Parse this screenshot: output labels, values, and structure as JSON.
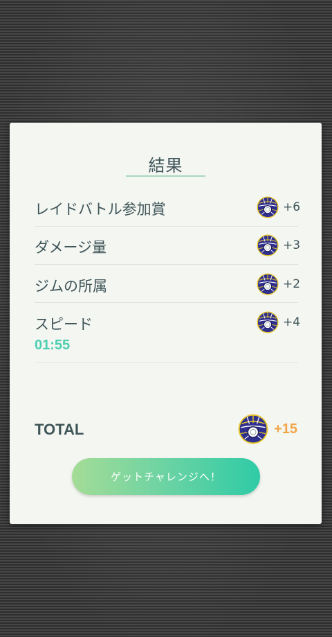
{
  "result": {
    "title": "結果",
    "rows": [
      {
        "label": "レイドバトル参加賞",
        "value": "+6",
        "icon": "premier-ball-icon"
      },
      {
        "label": "ダメージ量",
        "value": "+3",
        "icon": "premier-ball-icon"
      },
      {
        "label": "ジムの所属",
        "value": "+2",
        "icon": "premier-ball-icon"
      },
      {
        "label": "スピード",
        "sub": "01:55",
        "value": "+4",
        "icon": "premier-ball-icon"
      }
    ],
    "total_label": "TOTAL",
    "total_value": "+15",
    "cta_label": "ゲットチャレンジへ！"
  },
  "colors": {
    "card": "#f4f6f2",
    "text": "#3f5558",
    "accent_teal": "#4ccfb0",
    "total_orange": "#f1a548",
    "button_start": "#a4dc96",
    "button_end": "#2fcba6"
  }
}
